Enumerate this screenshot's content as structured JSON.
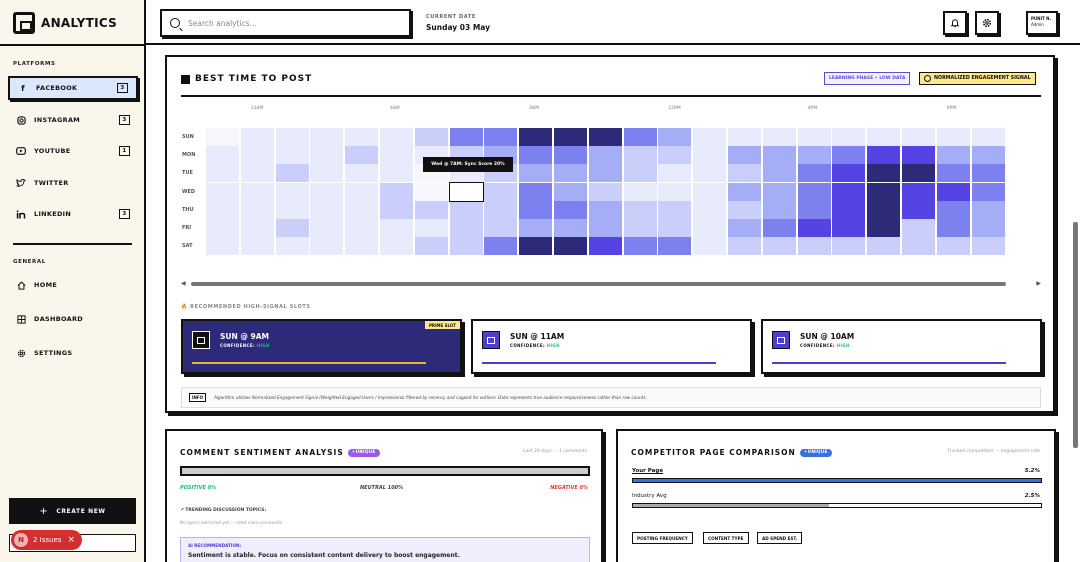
{
  "brand": {
    "name": "ANALYTICS"
  },
  "sidebar": {
    "platforms_label": "PLATFORMS",
    "platforms": [
      {
        "label": "FACEBOOK",
        "count": "3",
        "icon": "facebook-icon",
        "active": true
      },
      {
        "label": "INSTAGRAM",
        "count": "3",
        "icon": "instagram-icon"
      },
      {
        "label": "YOUTUBE",
        "count": "1",
        "icon": "youtube-icon"
      },
      {
        "label": "TWITTER",
        "count": "",
        "icon": "twitter-icon"
      },
      {
        "label": "LINKEDIN",
        "count": "3",
        "icon": "linkedin-icon"
      }
    ],
    "general_label": "GENERAL",
    "general": [
      {
        "label": "HOME",
        "icon": "home-icon"
      },
      {
        "label": "DASHBOARD",
        "icon": "grid-icon"
      },
      {
        "label": "SETTINGS",
        "icon": "gear-icon"
      }
    ],
    "create_label": "CREATE NEW",
    "issues": {
      "initial": "N",
      "label": "2 Issues"
    }
  },
  "topbar": {
    "search_placeholder": "Search analytics...",
    "date_label": "CURRENT DATE",
    "date_value": "Sunday 03 May",
    "user_name": "PUNIT N.",
    "user_role": "Admin"
  },
  "best_time": {
    "title": "BEST TIME TO POST",
    "tag_learning": "LEARNING PHASE • LOW DATA",
    "tag_normalized": "NORMALIZED ENGAGEMENT SIGNAL",
    "hours_labels": [
      "12AM",
      "4AM",
      "8AM",
      "12PM",
      "4PM",
      "8PM"
    ],
    "days": [
      "SUN",
      "MON",
      "TUE",
      "WED",
      "THU",
      "FRI",
      "SAT"
    ],
    "levels": [
      [
        0,
        1,
        1,
        1,
        1,
        1,
        2,
        4,
        4,
        6,
        6,
        6,
        4,
        3,
        1,
        1,
        1,
        1,
        1,
        1,
        1,
        1,
        1
      ],
      [
        1,
        1,
        1,
        1,
        2,
        1,
        1,
        2,
        3,
        4,
        4,
        3,
        2,
        2,
        1,
        3,
        3,
        3,
        4,
        5,
        5,
        3,
        3
      ],
      [
        1,
        1,
        2,
        1,
        1,
        1,
        0,
        1,
        2,
        3,
        3,
        3,
        2,
        1,
        1,
        2,
        3,
        4,
        5,
        6,
        6,
        4,
        4
      ],
      [
        1,
        1,
        1,
        1,
        1,
        2,
        0,
        0,
        2,
        4,
        3,
        2,
        1,
        1,
        1,
        3,
        3,
        4,
        5,
        6,
        5,
        5,
        4
      ],
      [
        1,
        1,
        1,
        1,
        1,
        2,
        2,
        2,
        2,
        4,
        4,
        3,
        2,
        2,
        1,
        2,
        3,
        4,
        5,
        6,
        5,
        4,
        3
      ],
      [
        1,
        1,
        2,
        1,
        1,
        1,
        1,
        2,
        2,
        3,
        3,
        3,
        2,
        2,
        1,
        3,
        4,
        5,
        5,
        6,
        2,
        4,
        3
      ],
      [
        1,
        1,
        1,
        1,
        1,
        1,
        2,
        2,
        4,
        6,
        6,
        5,
        4,
        4,
        1,
        2,
        2,
        2,
        2,
        2,
        2,
        2,
        2
      ]
    ],
    "tooltip": "Wed @ 7AM: Sync Score 20%",
    "recommended_label": "RECOMMENDED HIGH-SIGNAL SLOTS",
    "slots": [
      {
        "when": "SUN @ 9AM",
        "confidence_label": "CONFIDENCE:",
        "confidence": "HIGH",
        "prime": "PRIME SLOT"
      },
      {
        "when": "SUN @ 11AM",
        "confidence_label": "CONFIDENCE:",
        "confidence": "HIGH"
      },
      {
        "when": "SUN @ 10AM",
        "confidence_label": "CONFIDENCE:",
        "confidence": "HIGH"
      }
    ],
    "info_tag": "INFO",
    "info_text": "Algorithm utilizes Normalized Engagement Signal (Weighted Engaged Users / Impressions) filtered by recency and capped for outliers. Data represents true audience responsiveness rather than raw counts."
  },
  "sentiment": {
    "title": "COMMENT SENTIMENT ANALYSIS",
    "badge": "✦UNIQUE",
    "meta": "Last 30 days — 1 comments",
    "positive": "POSITIVE 0%",
    "neutral": "NEUTRAL 100%",
    "negative": "NEGATIVE 0%",
    "trending_label": "↗ TRENDING DISCUSSION TOPICS:",
    "trending_empty": "No topics extracted yet — need more comments.",
    "ai_label": "AI RECOMMENDATION:",
    "ai_text": "Sentiment is stable. Focus on consistent content delivery to boost engagement."
  },
  "competitor": {
    "title": "COMPETITOR PAGE COMPARISON",
    "badge": "✦UNIQUE",
    "meta": "Tracked competitors — engagement rate",
    "rows": [
      {
        "label": "Your Page",
        "value": "5.2%",
        "fill": 1.0
      },
      {
        "label": "Industry Avg",
        "value": "2.5%",
        "fill": 0.48
      }
    ],
    "chips": [
      "POSTING FREQUENCY",
      "CONTENT TYPE",
      "AD SPEND EST."
    ]
  },
  "colors": {
    "accent": "#4a3fd0",
    "prime": "#2e2a7a",
    "heat": [
      "#f6f7fd",
      "#e8ebfb",
      "#c9cffa",
      "#a5adf7",
      "#7d80ef",
      "#5544e3",
      "#2d2a7a"
    ]
  }
}
